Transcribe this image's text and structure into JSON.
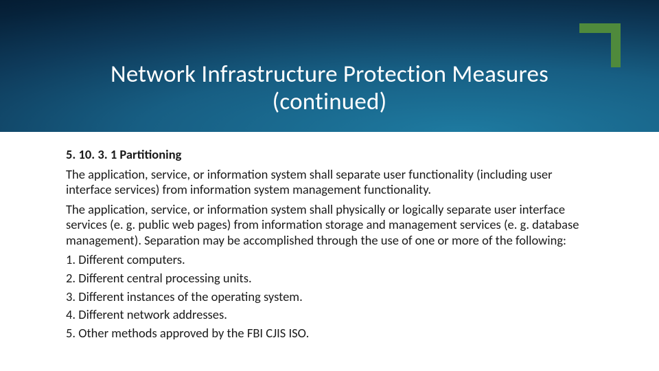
{
  "header": {
    "title_line1": "Network Infrastructure Protection Measures",
    "title_line2": "(continued)"
  },
  "content": {
    "section_number": "5. 10. 3. 1 Partitioning",
    "para1": "The application, service, or information system shall separate user functionality (including user interface services) from information system management functionality.",
    "para2": "The application, service, or information system shall physically or logically separate user interface services (e. g. public web pages) from information storage and management services (e. g. database management). Separation may be accomplished through the use of one or more of the following:",
    "items": [
      "1. Different computers.",
      "2. Different central processing units.",
      "3. Different instances of the operating system.",
      "4. Different network addresses.",
      "5. Other methods approved by the FBI CJIS ISO."
    ]
  }
}
